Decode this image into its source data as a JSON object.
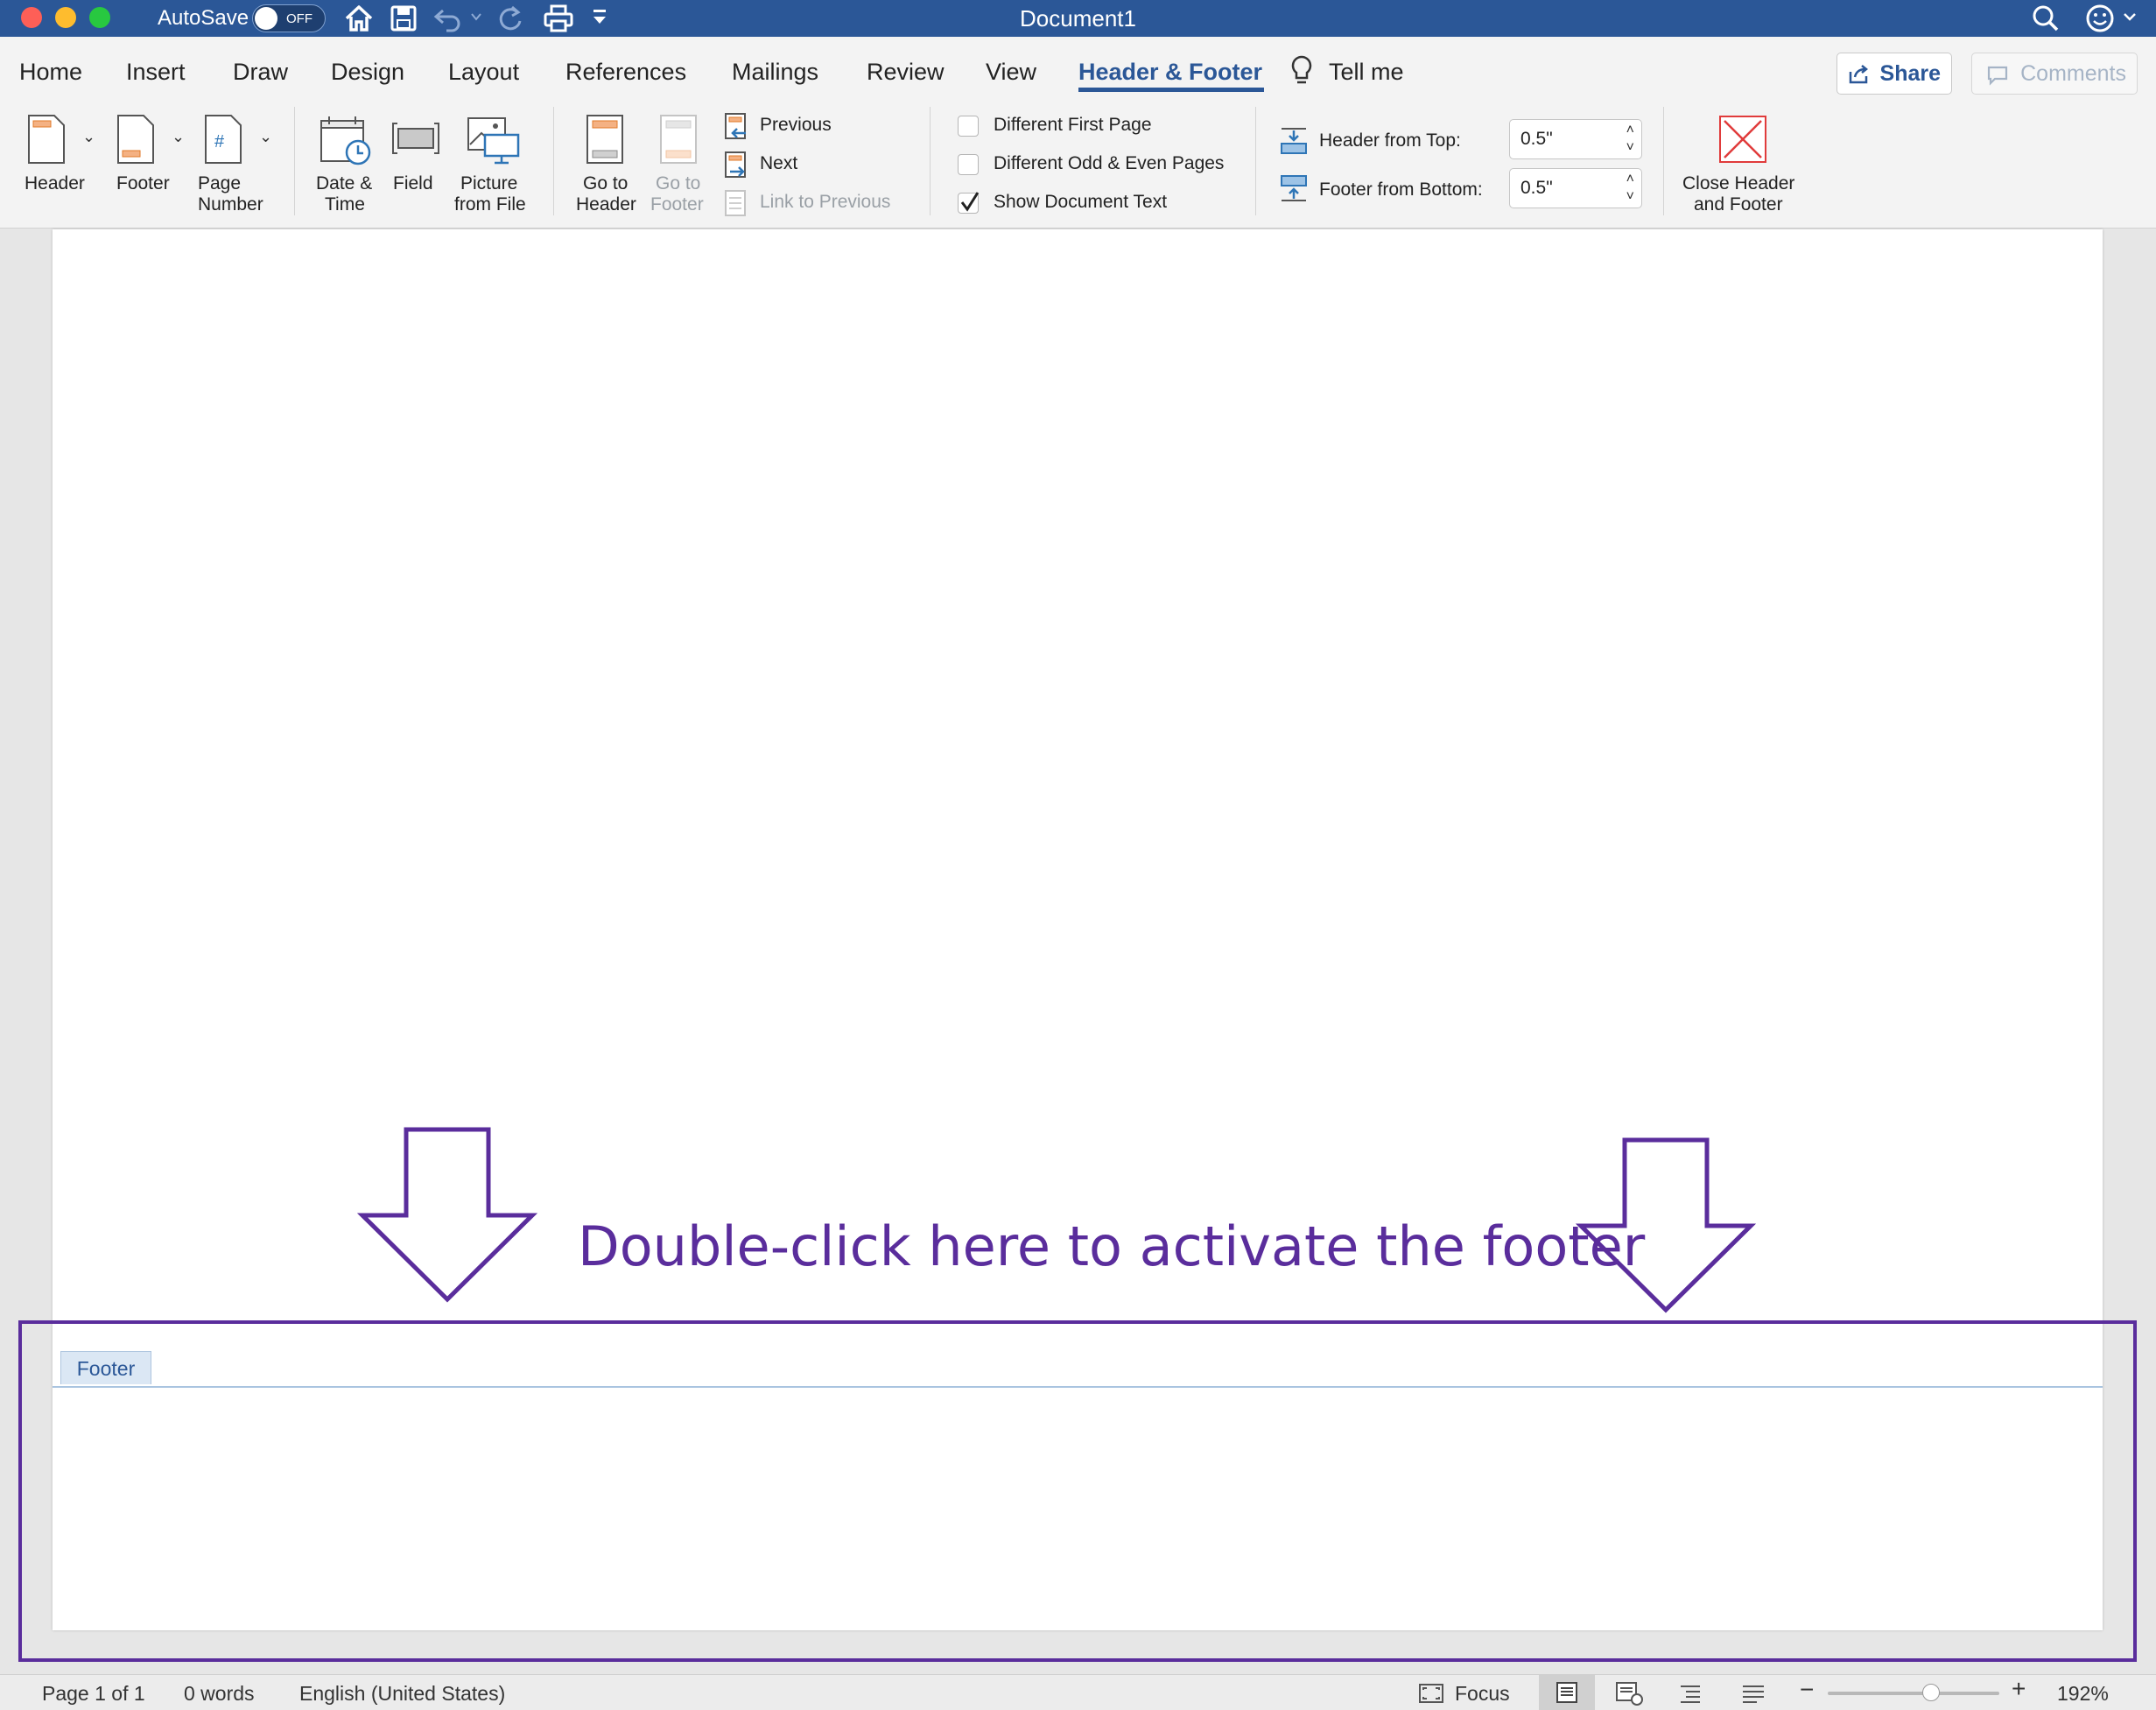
{
  "window": {
    "title": "Document1",
    "autosave_label": "AutoSave",
    "autosave_state": "OFF"
  },
  "tabs": [
    {
      "label": "Home"
    },
    {
      "label": "Insert"
    },
    {
      "label": "Draw"
    },
    {
      "label": "Design"
    },
    {
      "label": "Layout"
    },
    {
      "label": "References"
    },
    {
      "label": "Mailings"
    },
    {
      "label": "Review"
    },
    {
      "label": "View"
    },
    {
      "label": "Header & Footer"
    }
  ],
  "tell_me": "Tell me",
  "share_label": "Share",
  "comments_label": "Comments",
  "ribbon": {
    "header": "Header",
    "footer": "Footer",
    "page_number": [
      "Page",
      "Number"
    ],
    "date_time": [
      "Date &",
      "Time"
    ],
    "field": "Field",
    "picture": [
      "Picture",
      "from File"
    ],
    "go_header": [
      "Go to",
      "Header"
    ],
    "go_footer": [
      "Go to",
      "Footer"
    ],
    "previous": "Previous",
    "next": "Next",
    "link_previous": "Link to Previous",
    "diff_first": "Different First Page",
    "diff_odd_even": "Different Odd & Even Pages",
    "show_doc_text": "Show Document Text",
    "header_from_top_label": "Header from Top:",
    "header_from_top_value": "0.5\"",
    "footer_from_bottom_label": "Footer from Bottom:",
    "footer_from_bottom_value": "0.5\"",
    "close": [
      "Close Header",
      "and Footer"
    ]
  },
  "document": {
    "footer_tag": "Footer",
    "annotation": "Double-click here to activate the footer"
  },
  "status": {
    "page": "Page 1 of 1",
    "words": "0 words",
    "language": "English (United States)",
    "focus": "Focus",
    "zoom": "192%",
    "zoom_fraction": 0.6
  },
  "colors": {
    "titlebar": "#2b5797",
    "accent": "#2b5797",
    "annotation": "#5a2d9c"
  }
}
